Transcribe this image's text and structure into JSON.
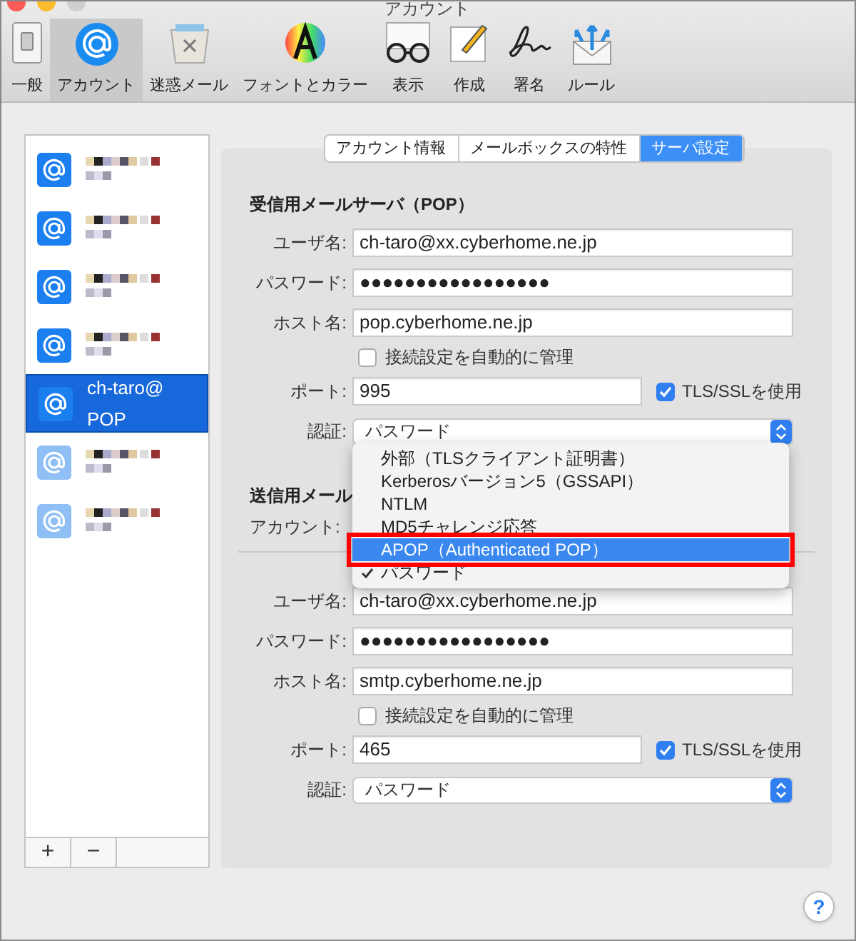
{
  "window": {
    "title": "アカウント"
  },
  "toolbar": {
    "items": [
      {
        "label": "一般",
        "kind": "general",
        "selected": false
      },
      {
        "label": "アカウント",
        "kind": "accounts",
        "selected": true
      },
      {
        "label": "迷惑メール",
        "kind": "junk",
        "selected": false
      },
      {
        "label": "フォントとカラー",
        "kind": "fonts",
        "selected": false
      },
      {
        "label": "表示",
        "kind": "viewing",
        "selected": false
      },
      {
        "label": "作成",
        "kind": "composing",
        "selected": false
      },
      {
        "label": "署名",
        "kind": "signature",
        "selected": false
      },
      {
        "label": "ルール",
        "kind": "rules",
        "selected": false
      }
    ]
  },
  "accounts": [
    {
      "kind": "blurred",
      "selected": false,
      "enabled": true
    },
    {
      "kind": "blurred",
      "selected": false,
      "enabled": true
    },
    {
      "kind": "blurred",
      "selected": false,
      "enabled": true
    },
    {
      "kind": "blurred",
      "selected": false,
      "enabled": true
    },
    {
      "kind": "named",
      "name": "ch-taro@",
      "type": "POP",
      "selected": true,
      "enabled": true
    },
    {
      "kind": "blurred",
      "selected": false,
      "enabled": false
    },
    {
      "kind": "blurred",
      "selected": false,
      "enabled": false
    }
  ],
  "account_buttons": [
    "+",
    "−"
  ],
  "help": "?",
  "tabs": [
    {
      "label": "アカウント情報",
      "selected": false
    },
    {
      "label": "メールボックスの特性",
      "selected": false
    },
    {
      "label": "サーバ設定",
      "selected": true
    }
  ],
  "incoming": {
    "title": "受信用メールサーバ（POP）",
    "user": {
      "label": "ユーザ名:",
      "value": "ch-taro@xx.cyberhome.ne.jp"
    },
    "password": {
      "label": "パスワード:",
      "value": "●●●●●●●●●●●●●●●●●"
    },
    "host": {
      "label": "ホスト名:",
      "value": "pop.cyberhome.ne.jp"
    },
    "auto_manage": {
      "label": "接続設定を自動的に管理",
      "checked": false
    },
    "port": {
      "label": "ポート:",
      "value": "995"
    },
    "tls": {
      "label": "TLS/SSLを使用",
      "checked": true
    },
    "auth": {
      "label": "認証:",
      "value": "パスワード"
    }
  },
  "auth_menu": {
    "items": [
      {
        "label": "外部（TLSクライアント証明書）",
        "selected": false,
        "checked": false
      },
      {
        "label": "Kerberosバージョン5（GSSAPI）",
        "selected": false,
        "checked": false
      },
      {
        "label": "NTLM",
        "selected": false,
        "checked": false
      },
      {
        "label": "MD5チャレンジ応答",
        "selected": false,
        "checked": false
      },
      {
        "label": "APOP（Authenticated POP）",
        "selected": true,
        "checked": false
      },
      {
        "label": "パスワード",
        "selected": false,
        "checked": true
      }
    ]
  },
  "outgoing": {
    "title": "送信用メール",
    "account_label": "アカウント:",
    "user": {
      "label": "ユーザ名:",
      "value": "ch-taro@xx.cyberhome.ne.jp"
    },
    "password": {
      "label": "パスワード:",
      "value": "●●●●●●●●●●●●●●●●●"
    },
    "host": {
      "label": "ホスト名:",
      "value": "smtp.cyberhome.ne.jp"
    },
    "auto_manage": {
      "label": "接続設定を自動的に管理",
      "checked": false
    },
    "port": {
      "label": "ポート:",
      "value": "465"
    },
    "tls": {
      "label": "TLS/SSLを使用",
      "checked": true
    },
    "auth": {
      "label": "認証:",
      "value": "パスワード"
    }
  }
}
